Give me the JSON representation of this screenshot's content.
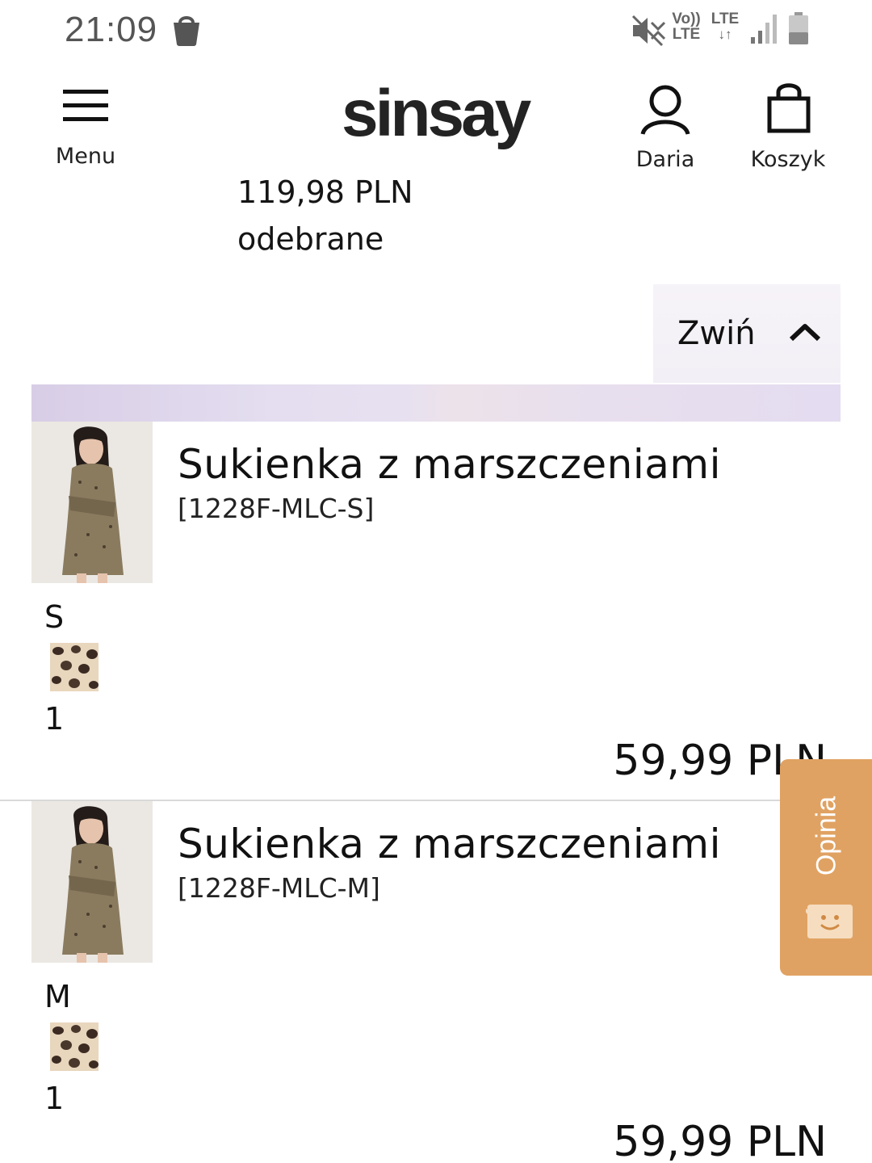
{
  "status_bar": {
    "time": "21:09",
    "volte_line1": "Vo))",
    "volte_line2": "LTE",
    "lte_label": "LTE",
    "lte_arrows": "↓↑",
    "icons": [
      "shopping-bag-icon",
      "mute-icon",
      "signal-icon",
      "battery-icon"
    ]
  },
  "header": {
    "menu_label": "Menu",
    "logo": "sinsay",
    "account_label": "Daria",
    "cart_label": "Koszyk"
  },
  "order": {
    "total": "119,98 PLN",
    "status": "odebrane",
    "collapse_label": "Zwiń"
  },
  "products": [
    {
      "name": "Sukienka z marszczeniami",
      "sku": "[1228F-MLC-S]",
      "size": "S",
      "quantity": "1",
      "price": "59,99 PLN"
    },
    {
      "name": "Sukienka z marszczeniami",
      "sku": "[1228F-MLC-M]",
      "size": "M",
      "quantity": "1",
      "price": "59,99 PLN"
    }
  ],
  "feedback": {
    "label": "Opinia",
    "color": "#e0a262"
  }
}
